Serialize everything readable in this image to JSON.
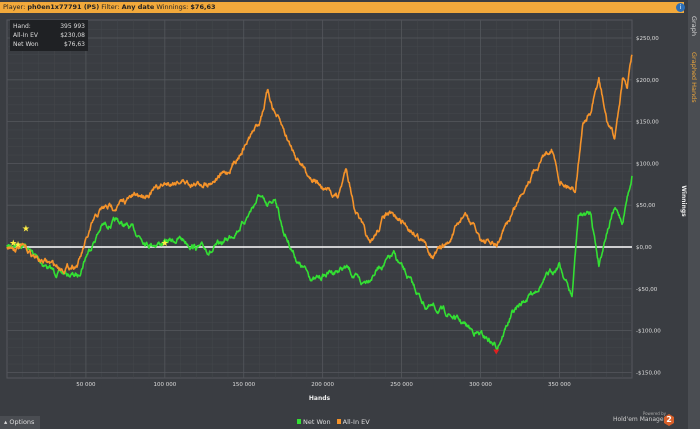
{
  "topbar": {
    "player_label": "Player:",
    "player": "ph0en1x77791 (PS)",
    "filter_label": "Filter:",
    "filter": "Any date",
    "winnings_label": "Winnings:",
    "winnings": "$76,63"
  },
  "sidebar": {
    "tabs": [
      {
        "label": "Graph"
      },
      {
        "label": "Graphed Hands"
      }
    ]
  },
  "stats": {
    "rows": [
      {
        "label": "Hand:",
        "value": "395 993"
      },
      {
        "label": "All-In EV",
        "value": "$230,08"
      },
      {
        "label": "Net Won",
        "value": "$76,63"
      }
    ]
  },
  "footer": {
    "options_label": "Options",
    "powered_by": "Powered by",
    "brand": "Hold'em Manager",
    "brand_badge": "2"
  },
  "colors": {
    "net_won": "#33e033",
    "all_in_ev": "#f5932a",
    "zero_line": "#ffffff",
    "star": "#ffee44",
    "marker": "#e02020"
  },
  "chart_data": {
    "type": "line",
    "xlabel": "Hands",
    "ylabel": "Winnings",
    "xlim": [
      0,
      396000
    ],
    "ylim": [
      -160,
      265
    ],
    "x_ticks": [
      {
        "v": 50000,
        "label": "50 000"
      },
      {
        "v": 100000,
        "label": "100 000"
      },
      {
        "v": 150000,
        "label": "150 000"
      },
      {
        "v": 200000,
        "label": "200 000"
      },
      {
        "v": 250000,
        "label": "250 000"
      },
      {
        "v": 300000,
        "label": "300 000"
      },
      {
        "v": 350000,
        "label": "350 000"
      }
    ],
    "y_ticks": [
      {
        "v": 250,
        "label": "$250,00"
      },
      {
        "v": 200,
        "label": "$200,00"
      },
      {
        "v": 150,
        "label": "$150,00"
      },
      {
        "v": 100,
        "label": "$100,00"
      },
      {
        "v": 50,
        "label": "$50,00"
      },
      {
        "v": 0,
        "label": "$0,00"
      },
      {
        "v": -50,
        "label": "-$50,00"
      },
      {
        "v": -100,
        "label": "-$100,00"
      },
      {
        "v": -150,
        "label": "-$150,00"
      }
    ],
    "legend": "bottom-center",
    "series": [
      {
        "name": "Net Won",
        "color": "#33e033",
        "points": [
          [
            0,
            0
          ],
          [
            10000,
            5
          ],
          [
            20000,
            -15
          ],
          [
            30000,
            -30
          ],
          [
            45000,
            -35
          ],
          [
            50000,
            -10
          ],
          [
            60000,
            25
          ],
          [
            70000,
            30
          ],
          [
            80000,
            20
          ],
          [
            90000,
            5
          ],
          [
            100000,
            5
          ],
          [
            110000,
            10
          ],
          [
            120000,
            0
          ],
          [
            130000,
            -5
          ],
          [
            140000,
            10
          ],
          [
            150000,
            30
          ],
          [
            160000,
            62
          ],
          [
            165000,
            45
          ],
          [
            170000,
            60
          ],
          [
            175000,
            20
          ],
          [
            185000,
            -20
          ],
          [
            195000,
            -40
          ],
          [
            205000,
            -30
          ],
          [
            215000,
            -25
          ],
          [
            225000,
            -45
          ],
          [
            235000,
            -25
          ],
          [
            245000,
            -10
          ],
          [
            255000,
            -40
          ],
          [
            265000,
            -70
          ],
          [
            280000,
            -80
          ],
          [
            295000,
            -100
          ],
          [
            305000,
            -110
          ],
          [
            310000,
            -120
          ],
          [
            320000,
            -80
          ],
          [
            330000,
            -60
          ],
          [
            340000,
            -40
          ],
          [
            350000,
            -20
          ],
          [
            358000,
            -60
          ],
          [
            362000,
            38
          ],
          [
            370000,
            40
          ],
          [
            375000,
            -20
          ],
          [
            380000,
            20
          ],
          [
            385000,
            45
          ],
          [
            390000,
            30
          ],
          [
            393000,
            60
          ],
          [
            396000,
            85
          ]
        ]
      },
      {
        "name": "All-In EV",
        "color": "#f5932a",
        "points": [
          [
            0,
            0
          ],
          [
            10000,
            0
          ],
          [
            20000,
            -15
          ],
          [
            35000,
            -25
          ],
          [
            45000,
            -20
          ],
          [
            55000,
            30
          ],
          [
            60000,
            45
          ],
          [
            70000,
            50
          ],
          [
            80000,
            60
          ],
          [
            90000,
            65
          ],
          [
            100000,
            75
          ],
          [
            110000,
            80
          ],
          [
            120000,
            75
          ],
          [
            130000,
            80
          ],
          [
            140000,
            90
          ],
          [
            150000,
            120
          ],
          [
            160000,
            150
          ],
          [
            165000,
            185
          ],
          [
            170000,
            160
          ],
          [
            180000,
            120
          ],
          [
            190000,
            90
          ],
          [
            200000,
            70
          ],
          [
            210000,
            60
          ],
          [
            215000,
            95
          ],
          [
            220000,
            50
          ],
          [
            230000,
            0
          ],
          [
            240000,
            40
          ],
          [
            250000,
            30
          ],
          [
            260000,
            15
          ],
          [
            270000,
            -10
          ],
          [
            280000,
            5
          ],
          [
            290000,
            40
          ],
          [
            300000,
            10
          ],
          [
            310000,
            0
          ],
          [
            320000,
            40
          ],
          [
            330000,
            80
          ],
          [
            340000,
            110
          ],
          [
            345000,
            120
          ],
          [
            350000,
            80
          ],
          [
            360000,
            70
          ],
          [
            365000,
            150
          ],
          [
            370000,
            160
          ],
          [
            375000,
            200
          ],
          [
            380000,
            150
          ],
          [
            385000,
            130
          ],
          [
            390000,
            200
          ],
          [
            393000,
            190
          ],
          [
            396000,
            230
          ]
        ]
      }
    ],
    "annotations": {
      "stars": [
        [
          4000,
          5
        ],
        [
          7000,
          3
        ],
        [
          12000,
          22
        ],
        [
          100000,
          5
        ]
      ],
      "min_marker": [
        310000,
        -125
      ]
    }
  }
}
